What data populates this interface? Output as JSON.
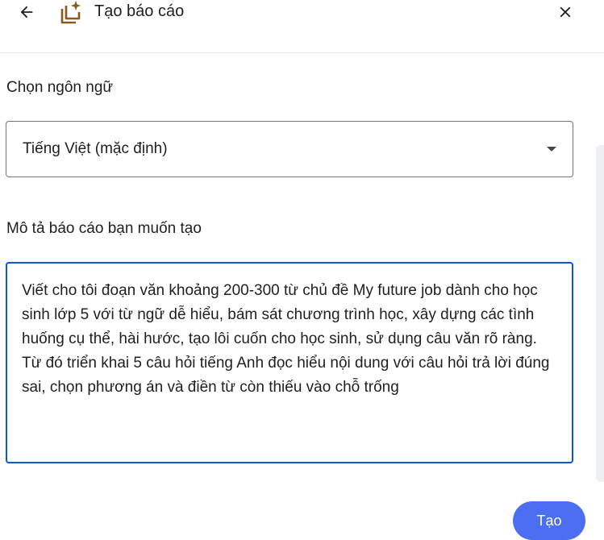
{
  "header": {
    "title": "Tạo báo cáo",
    "back_icon": "arrow-left-icon",
    "report_icon": "report-sparkle-icon",
    "close_icon": "close-icon"
  },
  "language": {
    "label": "Chọn ngôn ngữ",
    "selected": "Tiếng Việt (mặc định)"
  },
  "description": {
    "label": "Mô tả báo cáo bạn muốn tạo",
    "value": "Viết cho tôi đoạn văn khoảng 200-300 từ chủ đề My future job dành cho học sinh lớp 5 với từ ngữ dễ hiểu, bám sát chương trình học, xây dựng các tình huống cụ thể, hài hước, tạo lôi cuốn cho học sinh, sử dụng câu văn rõ ràng. Từ đó triển khai 5 câu hỏi tiếng Anh đọc hiểu nội dung với câu hỏi trả lời đúng sai, chọn phương án và điền từ còn thiếu vào chỗ trống"
  },
  "actions": {
    "submit_label": "Tạo"
  },
  "colors": {
    "accent": "#0b57d0",
    "button": "#4c6ef0",
    "icon_brown": "#8a5a1c"
  }
}
